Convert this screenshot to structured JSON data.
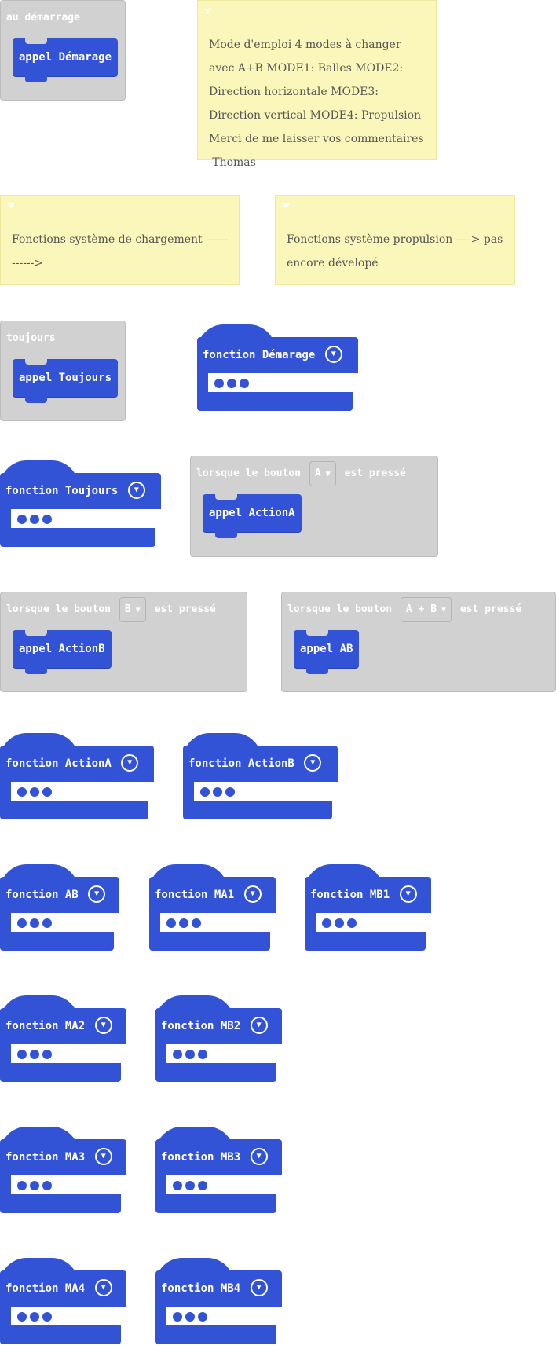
{
  "events": {
    "start": {
      "label": "au démarrage",
      "call": "appel Démarage"
    },
    "forever": {
      "label": "toujours",
      "call": "appel Toujours"
    },
    "button_a": {
      "prefix": "lorsque le bouton",
      "button": "A",
      "suffix": "est pressé",
      "call": "appel ActionA"
    },
    "button_b": {
      "prefix": "lorsque le bouton",
      "button": "B",
      "suffix": "est pressé",
      "call": "appel ActionB"
    },
    "button_ab": {
      "prefix": "lorsque le bouton",
      "button": "A + B",
      "suffix": "est pressé",
      "call": "appel AB"
    }
  },
  "comments": {
    "manual": "Mode d'emploi 4 modes à changer avec A+B MODE1: Balles MODE2: Direction horizontale MODE3: Direction vertical MODE4: Propulsion Merci de me laisser vos commentaires -Thomas",
    "loading": "Fonctions système de chargement ------------>",
    "propulsion": "Fonctions système propulsion ----> pas encore dévelopé"
  },
  "functions": {
    "demarage": "fonction Démarage",
    "toujours": "fonction Toujours",
    "actiona": "fonction ActionA",
    "actionb": "fonction ActionB",
    "ab": "fonction AB",
    "ma1": "fonction MA1",
    "mb1": "fonction MB1",
    "ma2": "fonction MA2",
    "mb2": "fonction MB2",
    "ma3": "fonction MA3",
    "mb3": "fonction MB3",
    "ma4": "fonction MA4",
    "mb4": "fonction MB4"
  },
  "icons": {
    "dropdown": "caret-down-icon",
    "collapse": "chevron-down-icon",
    "comment_toggle": "triangle-down-icon",
    "params": "ellipsis-dots-icon"
  },
  "colors": {
    "function_block": "#3353d6",
    "event_block": "#d1d1d1",
    "comment": "#fbf7bb"
  }
}
